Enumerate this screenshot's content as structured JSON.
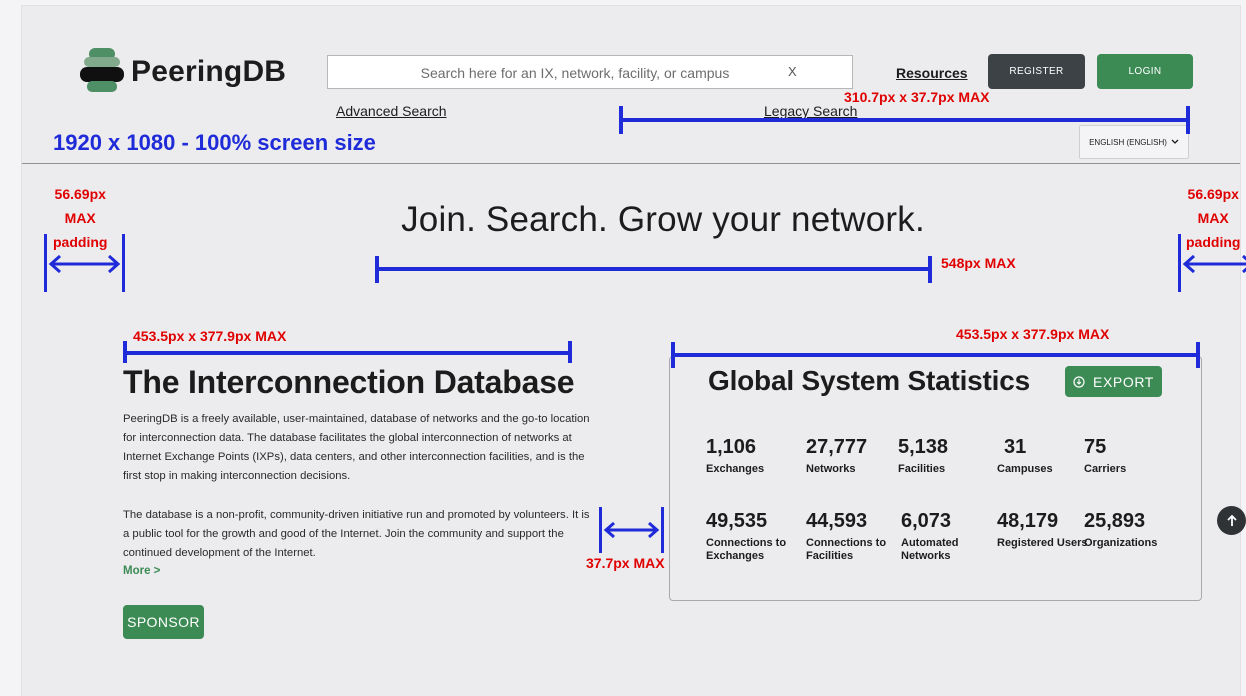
{
  "header": {
    "brand": "PeeringDB",
    "search": {
      "placeholder": "Search here for an IX, network, facility, or campus",
      "clear": "X"
    },
    "links": {
      "resources": "Resources",
      "advanced_search": "Advanced Search",
      "legacy_search": "Legacy Search"
    },
    "buttons": {
      "register": "REGISTER",
      "login": "LOGIN"
    },
    "language": "ENGLISH (ENGLISH)"
  },
  "hero": {
    "headline": "Join. Search. Grow your network."
  },
  "info": {
    "title": "The Interconnection Database",
    "paragraph1": "PeeringDB is a freely available, user-maintained, database of networks and the go-to location for interconnection data. The database facilitates the global interconnection of networks at Internet Exchange Points (IXPs), data centers, and other interconnection facilities, and is the first stop in making interconnection decisions.",
    "paragraph2": "The database is a non-profit, community-driven initiative run and promoted by volunteers. It is a public tool for the growth and good of the Internet. Join the community and support the continued development of the Internet.",
    "more": "More >",
    "sponsor": "SPONSOR"
  },
  "stats": {
    "title": "Global System Statistics",
    "export": "EXPORT",
    "items": [
      {
        "value": "1,106",
        "label": "Exchanges"
      },
      {
        "value": "27,777",
        "label": "Networks"
      },
      {
        "value": "5,138",
        "label": "Facilities"
      },
      {
        "value": "31",
        "label": "Campuses"
      },
      {
        "value": "75",
        "label": "Carriers"
      },
      {
        "value": "49,535",
        "label": "Connections to Exchanges"
      },
      {
        "value": "44,593",
        "label": "Connections to Facilities"
      },
      {
        "value": "6,073",
        "label": "Automated Networks"
      },
      {
        "value": "48,179",
        "label": "Registered Users"
      },
      {
        "value": "25,893",
        "label": "Organizations"
      }
    ]
  },
  "annotations": {
    "screen": "1920 x 1080 - 100% screen size",
    "nav_max": "310.7px x 37.7px MAX",
    "headline_max": "548px MAX",
    "left_padding": [
      "56.69px",
      "MAX",
      "padding"
    ],
    "right_padding": [
      "56.69px",
      "MAX",
      "padding"
    ],
    "left_box": "453.5px x 377.9px MAX",
    "right_box": "453.5px x 377.9px MAX",
    "gap": "37.7px MAX"
  },
  "colors": {
    "green": "#3c8b55",
    "dark": "#3d4246",
    "annotation_blue": "#1f2bd8",
    "annotation_red": "#e00000"
  }
}
